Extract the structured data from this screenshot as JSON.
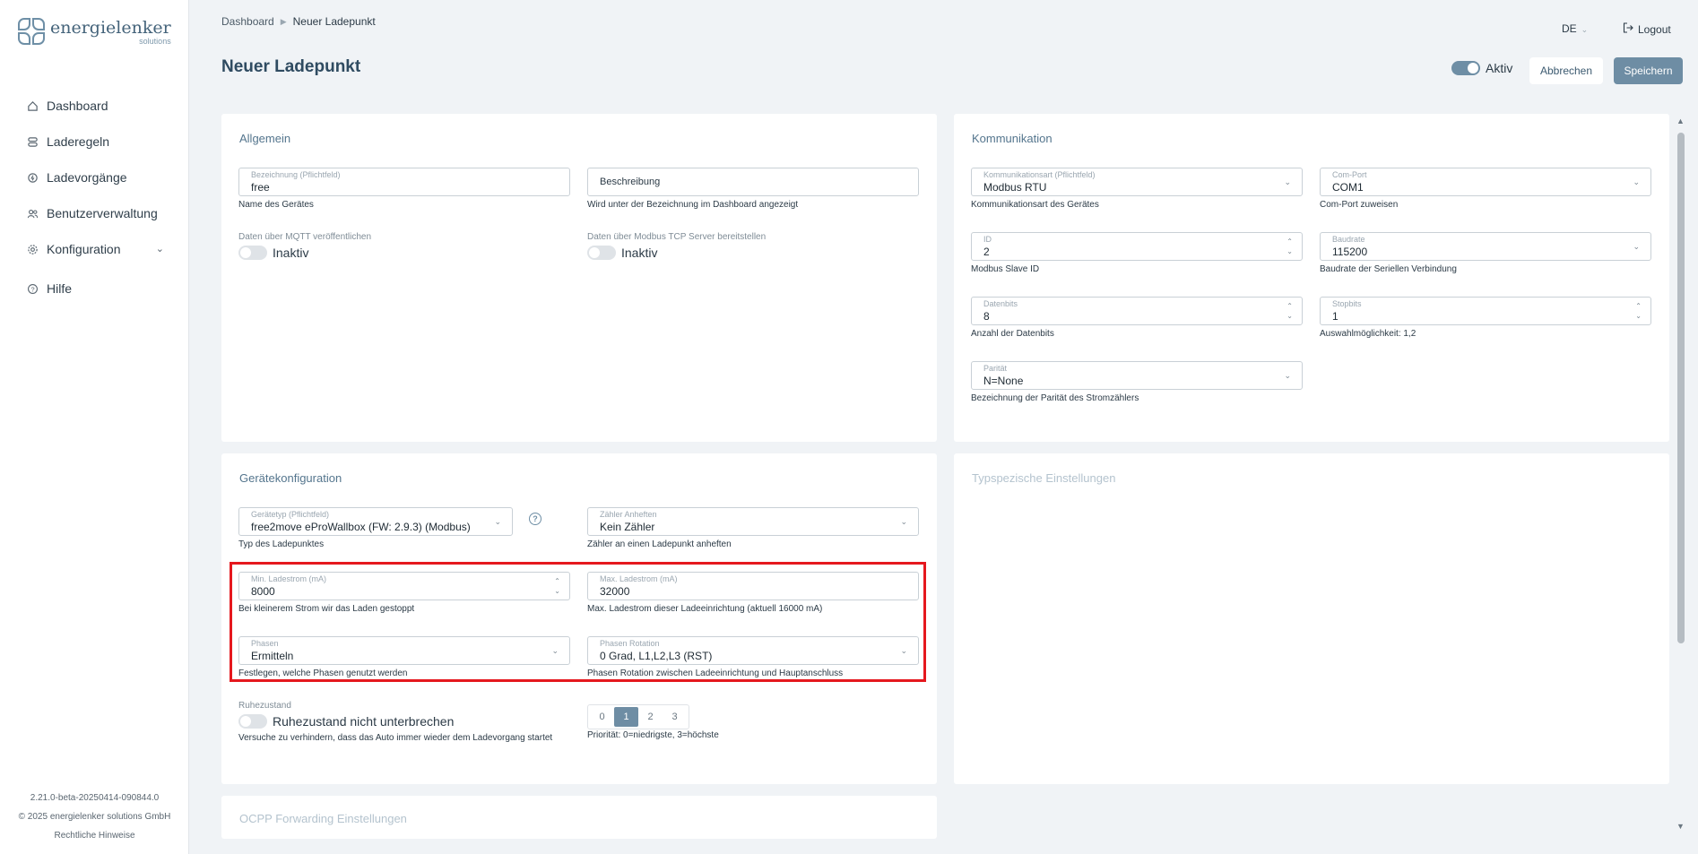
{
  "brand": {
    "name": "energielenker",
    "sub": "solutions"
  },
  "nav": {
    "items": [
      {
        "label": "Dashboard",
        "icon": "home-icon"
      },
      {
        "label": "Laderegeln",
        "icon": "rules-icon"
      },
      {
        "label": "Ladevorgänge",
        "icon": "charging-icon"
      },
      {
        "label": "Benutzerverwaltung",
        "icon": "users-icon"
      },
      {
        "label": "Konfiguration",
        "icon": "gear-icon"
      },
      {
        "label": "Hilfe",
        "icon": "help-icon"
      }
    ]
  },
  "footer": {
    "version": "2.21.0-beta-20250414-090844.0",
    "copyright": "© 2025 energielenker solutions GmbH",
    "legal": "Rechtliche Hinweise"
  },
  "breadcrumb": {
    "root": "Dashboard",
    "current": "Neuer Ladepunkt"
  },
  "header": {
    "lang": "DE",
    "logout": "Logout",
    "title": "Neuer Ladepunkt",
    "active_label": "Aktiv",
    "cancel": "Abbrechen",
    "save": "Speichern"
  },
  "allgemein": {
    "title": "Allgemein",
    "name_label": "Bezeichnung (Pflichtfeld)",
    "name_value": "free",
    "name_hint": "Name des Gerätes",
    "desc_placeholder": "Beschreibung",
    "desc_hint": "Wird unter der Bezeichnung im Dashboard angezeigt",
    "mqtt_label": "Daten über MQTT veröffentlichen",
    "mqtt_state": "Inaktiv",
    "modbus_label": "Daten über Modbus TCP Server bereitstellen",
    "modbus_state": "Inaktiv"
  },
  "kommunikation": {
    "title": "Kommunikation",
    "art_label": "Kommunikationsart (Pflichtfeld)",
    "art_value": "Modbus RTU",
    "art_hint": "Kommunikationsart des Gerätes",
    "port_label": "Com-Port",
    "port_value": "COM1",
    "port_hint": "Com-Port zuweisen",
    "id_label": "ID",
    "id_value": "2",
    "id_hint": "Modbus Slave ID",
    "baud_label": "Baudrate",
    "baud_value": "115200",
    "baud_hint": "Baudrate der Seriellen Verbindung",
    "databits_label": "Datenbits",
    "databits_value": "8",
    "databits_hint": "Anzahl der Datenbits",
    "stopbits_label": "Stopbits",
    "stopbits_value": "1",
    "stopbits_hint": "Auswahlmöglichkeit: 1,2",
    "parity_label": "Parität",
    "parity_value": "N=None",
    "parity_hint": "Bezeichnung der Parität des Stromzählers"
  },
  "geraet": {
    "title": "Gerätekonfiguration",
    "type_label": "Gerätetyp (Pflichtfeld)",
    "type_value": "free2move eProWallbox (FW: 2.9.3) (Modbus)",
    "type_hint": "Typ des Ladepunktes",
    "meter_label": "Zähler Anheften",
    "meter_value": "Kein Zähler",
    "meter_hint": "Zähler an einen Ladepunkt anheften",
    "min_label": "Min. Ladestrom (mA)",
    "min_value": "8000",
    "min_hint": "Bei kleinerem Strom wir das Laden gestoppt",
    "max_label": "Max. Ladestrom (mA)",
    "max_value": "32000",
    "max_hint": "Max. Ladestrom dieser Ladeeinrichtung (aktuell 16000 mA)",
    "phases_label": "Phasen",
    "phases_value": "Ermitteln",
    "phases_hint": "Festlegen, welche Phasen genutzt werden",
    "rotation_label": "Phasen Rotation",
    "rotation_value": "0 Grad, L1,L2,L3 (RST)",
    "rotation_hint": "Phasen Rotation zwischen Ladeeinrichtung und Hauptanschluss",
    "rest_label": "Ruhezustand",
    "rest_toggle": "Ruhezustand nicht unterbrechen",
    "rest_hint": "Versuche zu verhindern, dass das Auto immer wieder dem Ladevorgang startet",
    "priority_options": [
      "0",
      "1",
      "2",
      "3"
    ],
    "priority_selected": "1",
    "priority_hint": "Priorität: 0=niedrigste, 3=höchste"
  },
  "typspezifisch": {
    "title": "Typspezische Einstellungen"
  },
  "ocpp": {
    "title": "OCPP Forwarding Einstellungen"
  },
  "colors": {
    "accent": "#6e8da4",
    "highlight": "#e5181e",
    "bg": "#f0f3f6"
  }
}
